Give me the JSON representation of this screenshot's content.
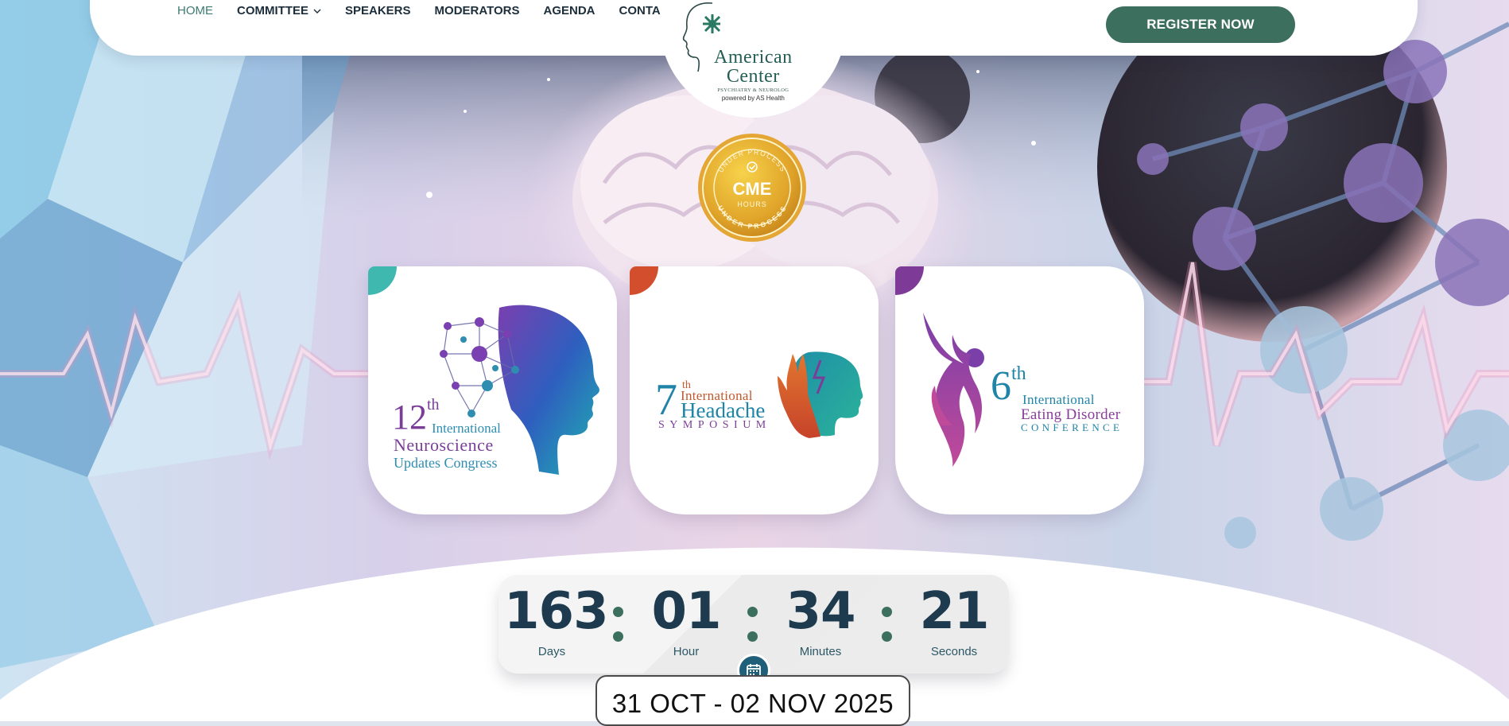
{
  "nav": {
    "items": [
      {
        "label": "HOME",
        "active": true
      },
      {
        "label": "COMMITTEE",
        "dropdown": true
      },
      {
        "label": "SPEAKERS"
      },
      {
        "label": "MODERATORS"
      },
      {
        "label": "AGENDA"
      },
      {
        "label": "CONTACT US"
      }
    ],
    "register_label": "REGISTER NOW"
  },
  "logo": {
    "line1": "American",
    "line2": "Center",
    "line3": "PSYCHIATRY & NEUROLOG",
    "line4": "powered by AS Health"
  },
  "badge": {
    "top_text": "UNDER PROCESS",
    "main": "CME",
    "sub": "HOURS",
    "bottom_text": "UNDER PROCESS"
  },
  "cards": [
    {
      "number": "12",
      "suffix": "th",
      "line1": "International",
      "line2": "Neuroscience",
      "line3": "Updates Congress",
      "corner_color": "#3fb8b0"
    },
    {
      "number": "7",
      "suffix": "th",
      "line1": "International",
      "line2": "Headache",
      "line3": "SYMPOSIUM",
      "corner_color": "#d24e2c"
    },
    {
      "number": "6",
      "suffix": "th",
      "line1": "International",
      "line2": "Eating Disorder",
      "line3": "CONFERENCE",
      "corner_color": "#7d3a97"
    }
  ],
  "countdown": {
    "units": [
      {
        "value": "163",
        "label": "Days"
      },
      {
        "value": "01",
        "label": "Hour"
      },
      {
        "value": "34",
        "label": "Minutes"
      },
      {
        "value": "21",
        "label": "Seconds"
      }
    ],
    "date": "31 OCT - 02 NOV 2025"
  },
  "colors": {
    "brand_green": "#3d6f5f",
    "nav_text": "#1d2e3b",
    "countdown_text": "#1d3a4e"
  }
}
